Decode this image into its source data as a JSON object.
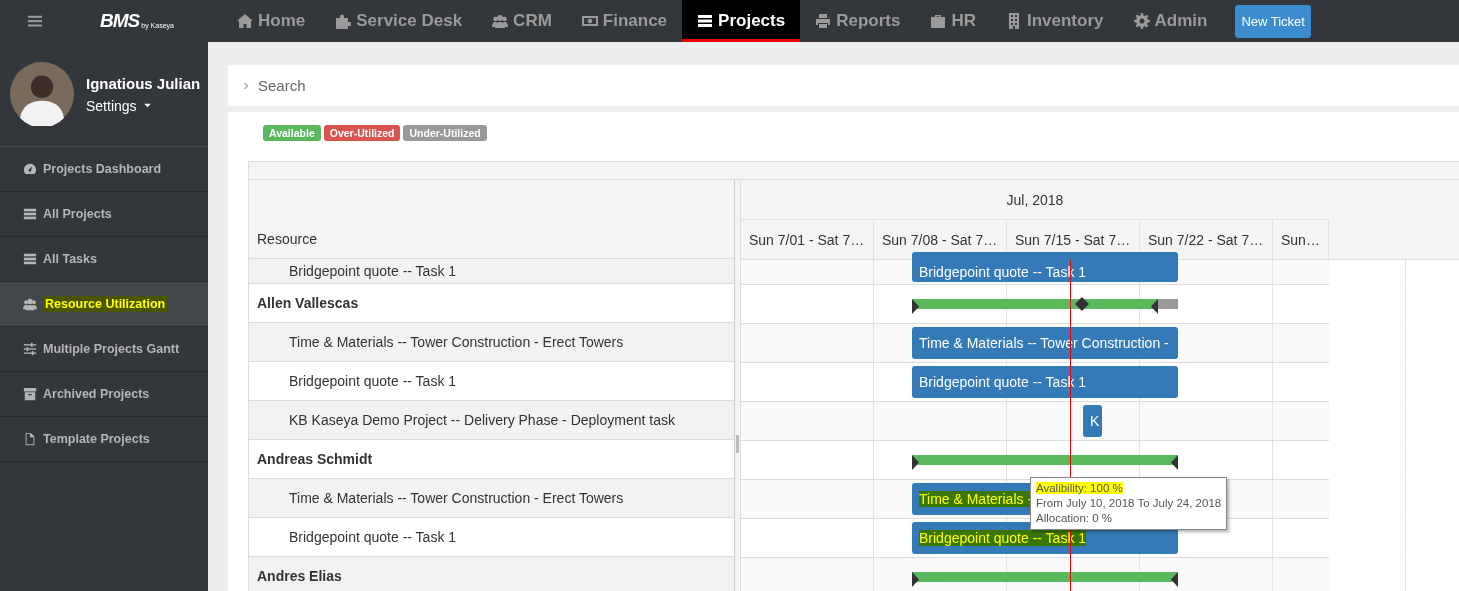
{
  "logo": {
    "text": "BMS",
    "subtext": "by Kaseya"
  },
  "nav": [
    {
      "label": "Home",
      "selected": false
    },
    {
      "label": "Service Desk",
      "selected": false
    },
    {
      "label": "CRM",
      "selected": false
    },
    {
      "label": "Finance",
      "selected": false
    },
    {
      "label": "Projects",
      "selected": true
    },
    {
      "label": "Reports",
      "selected": false
    },
    {
      "label": "HR",
      "selected": false
    },
    {
      "label": "Inventory",
      "selected": false
    },
    {
      "label": "Admin",
      "selected": false
    }
  ],
  "new_ticket_button": "New Ticket",
  "user": {
    "name": "Ignatious Julian",
    "menu": "Settings"
  },
  "sidebar": {
    "items": [
      {
        "label": "Projects Dashboard",
        "selected": false,
        "highlighted": false
      },
      {
        "label": "All Projects",
        "selected": false,
        "highlighted": false
      },
      {
        "label": "All Tasks",
        "selected": false,
        "highlighted": false
      },
      {
        "label": "Resource Utilization",
        "selected": true,
        "highlighted": true
      },
      {
        "label": "Multiple Projects Gantt",
        "selected": false,
        "highlighted": false
      },
      {
        "label": "Archived Projects",
        "selected": false,
        "highlighted": false
      },
      {
        "label": "Template Projects",
        "selected": false,
        "highlighted": false
      }
    ]
  },
  "search_panel": {
    "title": "Search"
  },
  "legend": [
    {
      "label": "Available",
      "color": "#5cb85c"
    },
    {
      "label": "Over-Utilized",
      "color": "#d9534f"
    },
    {
      "label": "Under-Utilized",
      "color": "#999999"
    }
  ],
  "gantt": {
    "resource_header": "Resource",
    "month": "Jul, 2018",
    "weeks": [
      "Sun 7/01 - Sat 7…",
      "Sun 7/08 - Sat 7…",
      "Sun 7/15 - Sat 7…",
      "Sun 7/22 - Sat 7…",
      "Sun…"
    ],
    "rows": [
      {
        "kind": "task",
        "name": "Bridgepoint quote -- Task 1",
        "bar": {
          "label": "Bridgepoint quote -- Task 1",
          "highlighted": false
        }
      },
      {
        "kind": "resource",
        "name": "Allen Vallescas",
        "segments": [
          {
            "color": "#5cb85c"
          },
          {
            "color": "#999999"
          }
        ],
        "milestone": true
      },
      {
        "kind": "task",
        "name": "Time & Materials -- Tower Construction - Erect Towers",
        "bar": {
          "label": "Time & Materials -- Tower Construction -",
          "highlighted": false
        }
      },
      {
        "kind": "task",
        "name": "Bridgepoint quote -- Task 1",
        "bar": {
          "label": "Bridgepoint quote -- Task 1",
          "highlighted": false
        }
      },
      {
        "kind": "task",
        "name": "KB Kaseya Demo Project -- Delivery Phase - Deployment task",
        "bar": {
          "label": "K",
          "highlighted": false
        }
      },
      {
        "kind": "resource",
        "name": "Andreas Schmidt",
        "segments": [
          {
            "color": "#5cb85c"
          }
        ],
        "milestone": false
      },
      {
        "kind": "task",
        "name": "Time & Materials -- Tower Construction - Erect Towers",
        "bar": {
          "label": "Time & Materials -",
          "highlighted": true
        }
      },
      {
        "kind": "task",
        "name": "Bridgepoint quote -- Task 1",
        "bar": {
          "label": "Bridgepoint quote -- Task 1",
          "highlighted": true
        }
      },
      {
        "kind": "resource",
        "name": "Andres Elias",
        "segments": [
          {
            "color": "#5cb85c"
          }
        ],
        "milestone": false
      }
    ],
    "tooltip": {
      "lines": [
        {
          "text": "Avalibility: 100 %",
          "highlighted": true
        },
        {
          "text": "From July 10, 2018 To July 24, 2018",
          "highlighted": false
        },
        {
          "text": "Allocation: 0 %",
          "highlighted": false
        }
      ]
    }
  }
}
